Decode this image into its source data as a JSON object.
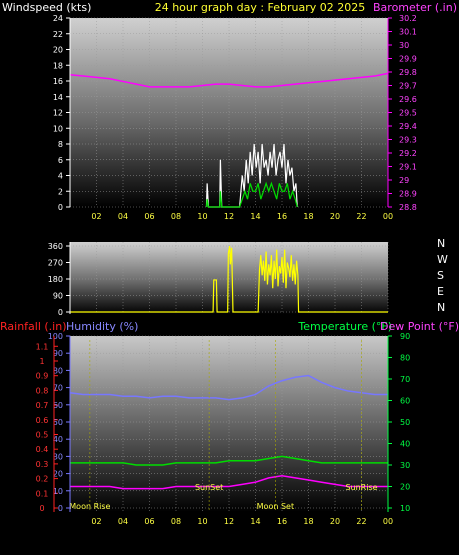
{
  "header": {
    "title": "24 hour graph day : February 02 2025",
    "left_label": "Windspeed (kts)",
    "right_label": "Barometer (.in)"
  },
  "colors": {
    "background": "#000000",
    "title": "#ffff33",
    "wind_gust": "#ffffff",
    "wind_avg": "#00dd00",
    "barometer": "#ff00ff",
    "direction": "#ffff00",
    "humidity": "#7777ff",
    "temperature": "#00dd00",
    "dew_point": "#ff00ff",
    "rainfall": "#ff2222",
    "temp_axis": "#00ff44",
    "dew_axis": "#ff00ff",
    "time_labels": "#ffff44"
  },
  "chart_data": [
    {
      "type": "line",
      "title": "24 hour graph day : February 02 2025",
      "x_ticks": [
        "02",
        "04",
        "06",
        "08",
        "10",
        "12",
        "14",
        "16",
        "18",
        "20",
        "22",
        "00"
      ],
      "xlim": [
        0,
        24
      ],
      "ylabel": "Windspeed (kts)",
      "y_ticks": [
        "0",
        "2",
        "4",
        "6",
        "8",
        "10",
        "12",
        "14",
        "16",
        "18",
        "20",
        "22",
        "24"
      ],
      "ylim": [
        0,
        24
      ],
      "y2label": "Barometer (.in)",
      "y2_ticks": [
        "28.8",
        "28.9",
        "29",
        "29.1",
        "29.2",
        "29.3",
        "29.4",
        "29.5",
        "29.6",
        "29.7",
        "29.8",
        "29.9",
        "30",
        "30.1",
        "30.2"
      ],
      "y2lim": [
        28.8,
        30.2
      ],
      "series": [
        {
          "axis": "y2",
          "x": [
            0,
            1,
            2,
            3,
            4,
            5,
            6,
            7,
            8,
            9,
            10,
            11,
            12,
            13,
            14,
            15,
            16,
            17,
            18,
            19,
            20,
            21,
            22,
            23,
            24
          ],
          "values": [
            29.78,
            29.77,
            29.76,
            29.75,
            29.73,
            29.71,
            29.69,
            29.69,
            29.69,
            29.69,
            29.7,
            29.71,
            29.71,
            29.7,
            29.69,
            29.69,
            29.7,
            29.71,
            29.72,
            29.73,
            29.74,
            29.75,
            29.76,
            29.77,
            29.79
          ]
        },
        {
          "axis": "y",
          "x": [
            10.3,
            10.35,
            10.45,
            11.3,
            11.35,
            11.45,
            12.8,
            13,
            13.15,
            13.3,
            13.45,
            13.6,
            13.75,
            13.9,
            14.05,
            14.2,
            14.35,
            14.5,
            14.65,
            14.8,
            14.95,
            15.1,
            15.25,
            15.4,
            15.55,
            15.7,
            15.85,
            16,
            16.15,
            16.3,
            16.45,
            16.6,
            16.75,
            16.9,
            17.05,
            17.15
          ],
          "values": [
            0,
            3,
            0,
            0,
            6,
            0,
            0,
            4,
            2,
            6,
            3,
            7,
            4,
            8,
            5,
            7,
            3,
            8,
            5,
            6,
            4,
            7,
            5,
            8,
            4,
            6,
            7,
            5,
            8,
            3,
            6,
            4,
            5,
            2,
            3,
            0
          ]
        },
        {
          "axis": "y",
          "x": [
            10.3,
            10.35,
            10.45,
            11.3,
            11.35,
            11.45,
            12.8,
            13,
            13.2,
            13.4,
            13.6,
            13.8,
            14,
            14.2,
            14.4,
            14.6,
            14.8,
            15,
            15.2,
            15.4,
            15.6,
            15.8,
            16,
            16.2,
            16.4,
            16.6,
            16.8,
            17,
            17.15
          ],
          "values": [
            0,
            1,
            0,
            0,
            2,
            0,
            0,
            1,
            2,
            1,
            3,
            2,
            2,
            3,
            1,
            2,
            3,
            2,
            3,
            2,
            1,
            3,
            2,
            2,
            3,
            1,
            2,
            1,
            0
          ]
        }
      ]
    },
    {
      "type": "line",
      "ylabel_ticks": [
        "360",
        "270",
        "180",
        "90",
        "0"
      ],
      "ylim": [
        0,
        360
      ],
      "compass_labels": [
        "N",
        "W",
        "S",
        "E",
        "N"
      ],
      "xlim": [
        0,
        24
      ],
      "series": [
        {
          "x": [
            0,
            10.8,
            10.85,
            11.05,
            11.1,
            11.2,
            11.9,
            11.95,
            12.05,
            12.1,
            12.2,
            12.3,
            12.4,
            12.5,
            12.55,
            12.6,
            14.2,
            14.3,
            14.4,
            14.5,
            14.6,
            14.7,
            14.8,
            14.9,
            15,
            15.1,
            15.2,
            15.3,
            15.4,
            15.5,
            15.6,
            15.7,
            15.8,
            15.9,
            16,
            16.1,
            16.2,
            16.3,
            16.4,
            16.5,
            16.6,
            16.7,
            16.8,
            16.9,
            17,
            17.1,
            17.2,
            17.25,
            17.3,
            24
          ],
          "values": [
            0,
            0,
            175,
            175,
            0,
            0,
            0,
            320,
            360,
            260,
            350,
            0,
            0,
            0,
            0,
            0,
            0,
            230,
            310,
            200,
            280,
            170,
            330,
            150,
            260,
            200,
            310,
            130,
            280,
            180,
            340,
            140,
            250,
            210,
            300,
            160,
            340,
            130,
            270,
            240,
            190,
            310,
            170,
            260,
            150,
            280,
            200,
            0,
            0,
            0
          ]
        }
      ]
    },
    {
      "type": "line",
      "left_outer_label": "Rainfall (.in)",
      "left_inner_label": "Humidity (%)",
      "right_inner_label": "Temperature (°F)",
      "right_outer_label": "Dew Point (°F)",
      "xlim": [
        0,
        24
      ],
      "x_ticks": [
        "02",
        "04",
        "06",
        "08",
        "10",
        "12",
        "14",
        "16",
        "18",
        "20",
        "22",
        "00"
      ],
      "rain_ticks": [
        "0",
        "0.1",
        "0.2",
        "0.3",
        "0.4",
        "0.5",
        "0.6",
        "0.7",
        "0.8",
        "0.9",
        "1",
        "1.1"
      ],
      "humidity_ticks": [
        "0",
        "10",
        "20",
        "30",
        "40",
        "50",
        "60",
        "70",
        "80",
        "90",
        "100"
      ],
      "humidity_lim": [
        0,
        100
      ],
      "temp_ticks": [
        "10",
        "20",
        "30",
        "40",
        "50",
        "60",
        "70",
        "80",
        "90"
      ],
      "temp_lim": [
        10,
        90
      ],
      "series": [
        {
          "axis": "humidity",
          "x": [
            0,
            1,
            2,
            3,
            4,
            5,
            6,
            7,
            8,
            9,
            10,
            11,
            12,
            13,
            14,
            15,
            16,
            17,
            18,
            19,
            20,
            21,
            22,
            23,
            24
          ],
          "values": [
            67,
            66,
            66,
            66,
            65,
            65,
            64,
            65,
            65,
            64,
            64,
            64,
            63,
            64,
            66,
            71,
            74,
            76,
            77,
            73,
            70,
            68,
            67,
            66,
            66
          ]
        },
        {
          "axis": "temp",
          "x": [
            0,
            1,
            2,
            3,
            4,
            5,
            6,
            7,
            8,
            9,
            10,
            11,
            12,
            13,
            14,
            15,
            16,
            17,
            18,
            19,
            20,
            21,
            22,
            23,
            24
          ],
          "values": [
            31,
            31,
            31,
            31,
            31,
            30,
            30,
            30,
            31,
            31,
            31,
            31,
            32,
            32,
            32,
            33,
            34,
            33,
            32,
            31,
            31,
            31,
            31,
            31,
            31
          ]
        },
        {
          "axis": "temp",
          "x": [
            0,
            1,
            2,
            3,
            4,
            5,
            6,
            7,
            8,
            9,
            10,
            11,
            12,
            13,
            14,
            15,
            16,
            17,
            18,
            19,
            20,
            21,
            22,
            23,
            24
          ],
          "values": [
            20,
            20,
            20,
            20,
            19,
            19,
            19,
            19,
            20,
            20,
            20,
            20,
            20,
            21,
            22,
            24,
            25,
            24,
            23,
            22,
            21,
            20,
            20,
            20,
            20
          ]
        }
      ],
      "events": [
        {
          "label": "Moon Rise",
          "x": 1.5
        },
        {
          "label": "SunSet",
          "x": 10.5
        },
        {
          "label": "Moon Set",
          "x": 15.5
        },
        {
          "label": "SunRise",
          "x": 22
        }
      ]
    }
  ]
}
